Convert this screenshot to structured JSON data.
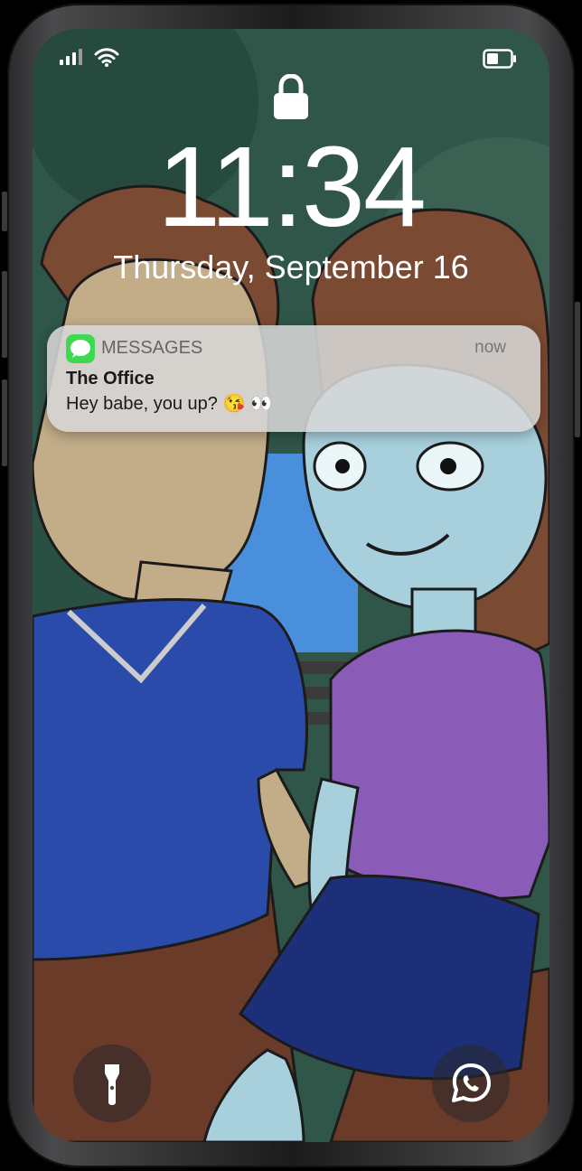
{
  "status_bar": {
    "signal_icon": "cellular-signal-icon",
    "wifi_icon": "wifi-icon",
    "battery_icon": "battery-icon"
  },
  "lock_screen": {
    "lock_icon": "padlock-icon",
    "time": "11:34",
    "date": "Thursday, September 16"
  },
  "notification": {
    "app_icon": "messages-app-icon",
    "app_name": "MESSAGES",
    "time": "now",
    "title": "The Office",
    "body": "Hey babe, you up? 😘 👀"
  },
  "quick_actions": {
    "flashlight_icon": "flashlight-icon",
    "whatsapp_icon": "whatsapp-icon"
  },
  "colors": {
    "messages_green": "#3ed94f",
    "notification_bg": "#d7d7d7",
    "text_white": "#ffffff"
  }
}
